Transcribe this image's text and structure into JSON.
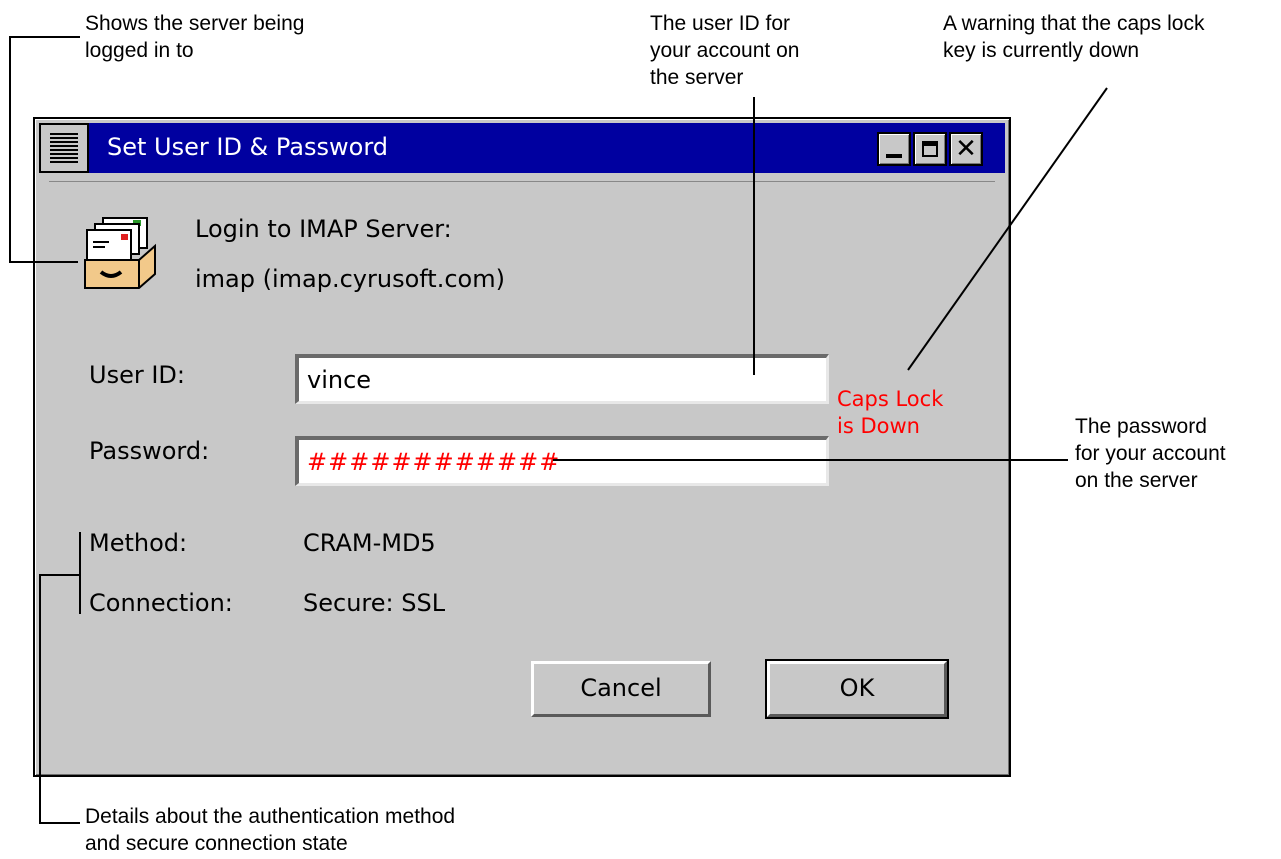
{
  "annotations": {
    "server": "Shows the server being\nlogged in to",
    "user_id": "The user ID for\nyour account on\nthe server",
    "caps_warning": "A warning that the caps lock\nkey is currently down",
    "password": "The password\nfor your account\non the server",
    "details": "Details about the authentication method\nand secure connection state"
  },
  "window": {
    "title": "Set User ID & Password",
    "titlebar_color": "#0000a0",
    "icons": [
      "menu-icon",
      "minimize-icon",
      "maximize-icon",
      "close-icon"
    ],
    "close_glyph": "✕"
  },
  "dialog": {
    "server_heading": "Login to IMAP Server:",
    "server_name": "imap (imap.cyrusoft.com)",
    "user_id_label": "User ID:",
    "user_id_value": "vince",
    "password_label": "Password:",
    "password_value": "############",
    "password_color": "#ff0000",
    "caps_lock_warning": "Caps Lock\nis Down",
    "method_label": "Method:",
    "method_value": "CRAM-MD5",
    "connection_label": "Connection:",
    "connection_value": "Secure: SSL",
    "cancel_label": "Cancel",
    "ok_label": "OK"
  }
}
